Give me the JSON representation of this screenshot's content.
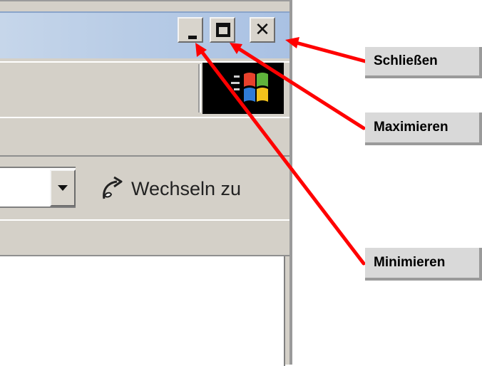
{
  "window": {
    "buttons": {
      "minimize_icon": "minimize-icon",
      "maximize_icon": "maximize-icon",
      "close_icon": "close-icon",
      "close_glyph": "✕"
    },
    "address_bar": {
      "go_label": "Wechseln zu",
      "go_icon": "go-arrow-icon"
    },
    "logo": "windows-flag-logo"
  },
  "callouts": {
    "close": "Schließen",
    "maximize": "Maximieren",
    "minimize": "Minimieren"
  },
  "colors": {
    "arrow": "#ff0000",
    "titlebar": "#b8cce6",
    "chrome": "#d4d0c8"
  }
}
